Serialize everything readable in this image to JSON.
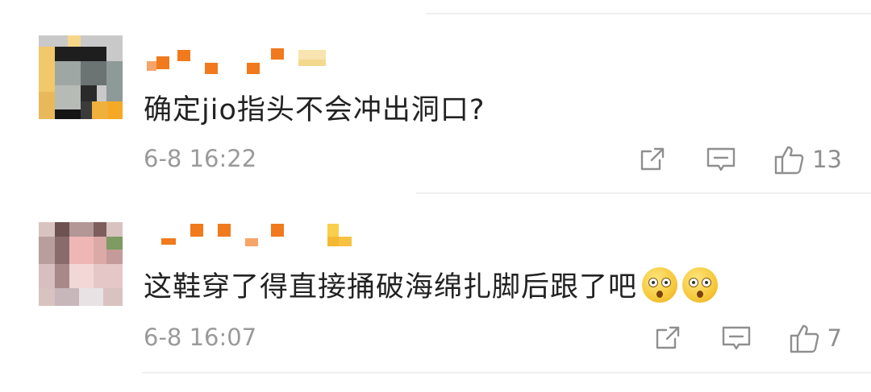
{
  "comments": [
    {
      "text": "确定jio指头不会冲出洞口?",
      "time": "6-8 16:22",
      "like_count": "13",
      "icons": [
        "share-icon",
        "reply-icon",
        "like-icon"
      ]
    },
    {
      "text": "这鞋穿了得直接捅破海绵扎脚后跟了吧",
      "time": "6-8 16:07",
      "like_count": "7",
      "emojis": [
        "astonished-emoji",
        "astonished-emoji"
      ],
      "icons": [
        "share-icon",
        "reply-icon",
        "like-icon"
      ]
    }
  ],
  "colors": {
    "text": "#222222",
    "meta": "#9a9a9a",
    "username_blocks": "#f07a1d",
    "divider": "#f0f0f0"
  }
}
